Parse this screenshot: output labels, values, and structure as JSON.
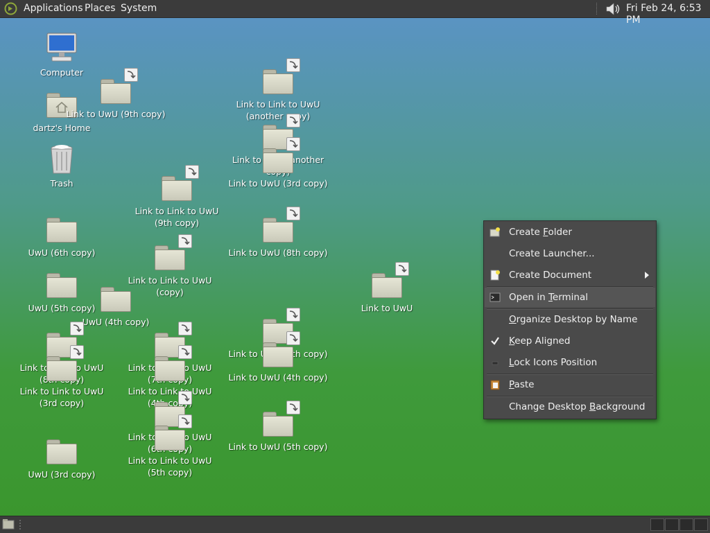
{
  "top_panel": {
    "menus": [
      "Applications",
      "Places",
      "System"
    ],
    "clock": "Fri Feb 24,  6:53 PM"
  },
  "desktop": {
    "icons": [
      {
        "label": "Computer"
      },
      {
        "label": "dartz's Home"
      },
      {
        "label": "Trash"
      },
      {
        "label": "Link to UwU (9th copy)"
      },
      {
        "label": "Link to Link to UwU (another copy)"
      },
      {
        "label": "Link to UwU (another copy)"
      },
      {
        "label": "Link to UwU (3rd copy)"
      },
      {
        "label": "Link to Link to UwU (9th copy)"
      },
      {
        "label": "UwU (6th copy)"
      },
      {
        "label": "Link to UwU (8th copy)"
      },
      {
        "label": "Link to Link to UwU (copy)"
      },
      {
        "label": "Link to UwU"
      },
      {
        "label": "UwU (5th copy)"
      },
      {
        "label": "UwU (4th copy)"
      },
      {
        "label": "Link to UwU (6th copy)"
      },
      {
        "label": "Link to UwU (4th copy)"
      },
      {
        "label": "Link to Link to UwU (8th copy)"
      },
      {
        "label": "Link to Link to UwU (7th copy)"
      },
      {
        "label": "Link to Link to UwU (3rd copy)"
      },
      {
        "label": "Link to Link to UwU (4th copy)"
      },
      {
        "label": "Link to Link to UwU (6th copy)"
      },
      {
        "label": "Link to Link to UwU (5th copy)"
      },
      {
        "label": "Link to UwU (5th copy)"
      },
      {
        "label": "UwU (3rd copy)"
      }
    ]
  },
  "context_menu": {
    "items": [
      {
        "pre": "Create ",
        "mnemonic": "F",
        "post": "older",
        "icon": "new-folder-icon"
      },
      {
        "pre": "Create Launcher...",
        "mnemonic": "",
        "post": "",
        "icon": ""
      },
      {
        "pre": "Create Document",
        "mnemonic": "",
        "post": "",
        "icon": "new-document-icon",
        "submenu": true
      },
      {
        "pre": "Open in ",
        "mnemonic": "T",
        "post": "erminal",
        "icon": "terminal-icon"
      },
      {
        "pre": "",
        "mnemonic": "O",
        "post": "rganize Desktop by Name",
        "icon": ""
      },
      {
        "pre": "",
        "mnemonic": "K",
        "post": "eep Aligned",
        "icon": "checkmark-icon"
      },
      {
        "pre": "",
        "mnemonic": "L",
        "post": "ock Icons Position",
        "icon": "lock-checkbox-icon"
      },
      {
        "pre": "",
        "mnemonic": "P",
        "post": "aste",
        "icon": "paste-icon"
      },
      {
        "pre": "Change Desktop ",
        "mnemonic": "B",
        "post": "ackground",
        "icon": ""
      }
    ]
  }
}
